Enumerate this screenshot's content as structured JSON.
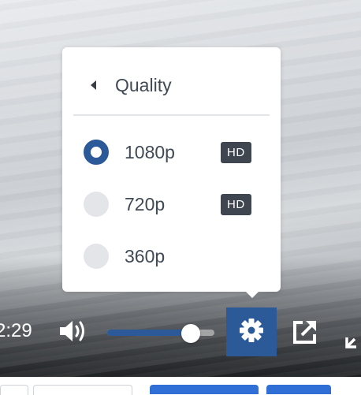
{
  "player": {
    "current_time": "2:29",
    "volume_level": 0.78,
    "colors": {
      "accent": "#2c5a99",
      "badge": "#3f4650",
      "menu_text": "#3f4a55"
    }
  },
  "quality_menu": {
    "title": "Quality",
    "back_icon": "chevron-left-icon",
    "options": [
      {
        "label": "1080p",
        "badge": "HD",
        "selected": true
      },
      {
        "label": "720p",
        "badge": "HD",
        "selected": false
      },
      {
        "label": "360p",
        "badge": "",
        "selected": false
      }
    ]
  },
  "icons": {
    "volume": "volume-icon",
    "settings": "gear-icon",
    "popout": "external-link-icon",
    "fullscreen": "fullscreen-exit-icon"
  }
}
